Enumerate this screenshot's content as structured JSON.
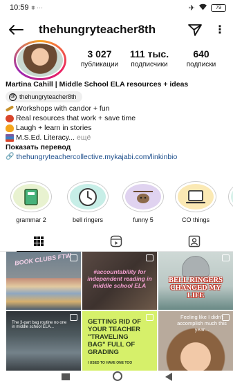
{
  "status_bar": {
    "time": "10:59",
    "notif_icons": "⩨ ···",
    "battery": "79"
  },
  "header": {
    "username": "thehungryteacher8th"
  },
  "stats": {
    "posts": {
      "value": "3 027",
      "label": "публикации"
    },
    "followers": {
      "value": "111 тыс.",
      "label": "подписчики"
    },
    "following": {
      "value": "640",
      "label": "подписки"
    }
  },
  "bio": {
    "name": "Martina Cahill | Middle School ELA resources + ideas",
    "threads_handle": "thehungryteacher8th",
    "lines": [
      {
        "text": "Workshops with candor + fun",
        "emoji_color": "#c8912b"
      },
      {
        "text": "Real resources that work + save time",
        "emoji_color": "#d9452b"
      },
      {
        "text": "Laugh + learn in stories",
        "emoji_color": "#f4a51c"
      },
      {
        "text": "M.S.Ed. Literacy...",
        "emoji_color": "#7c5a9e"
      }
    ],
    "more": "ещё",
    "translate": "Показать перевод",
    "link": "thehungryteachercollective.mykajabi.com/linkinbio"
  },
  "highlights": [
    {
      "label": "grammar 2",
      "color": "#e8f2d0",
      "icon": "notebook-icon"
    },
    {
      "label": "bell ringers",
      "color": "#c7eee7",
      "icon": "clock-icon"
    },
    {
      "label": "funny 5",
      "color": "#e0d3f0",
      "icon": "sloth-icon"
    },
    {
      "label": "CO things",
      "color": "#fbe9b4",
      "icon": "laptop-icon"
    }
  ],
  "posts": [
    {
      "text": "BOOK CLUBS FTW",
      "bg": "#6e7f8c",
      "text_color": "#f4d2e8"
    },
    {
      "text": "#accountability for independent reading in middle school ELA",
      "bg": "#4a3c38",
      "text_color": "#f29fcf"
    },
    {
      "text": "BELL RINGERS CHANGED MY LIFE",
      "bg": "#cfd9d6",
      "text_color": "#ffffff"
    },
    {
      "text": "The 3-part bag routine no one in middle school ELA...",
      "bg": "#2f3438",
      "text_color": "#ffffff"
    },
    {
      "text": "GETTING RID OF YOUR TEACHER \"TRAVELING BAG\" FULL OF GRADING",
      "sub": "I USED TO HAVE ONE TOO",
      "bg": "#d6f06a",
      "text_color": "#2b3a20"
    },
    {
      "text": "Feeling like I didn't accomplish much this year...",
      "bg": "#a79889",
      "text_color": "#ffffff"
    }
  ]
}
